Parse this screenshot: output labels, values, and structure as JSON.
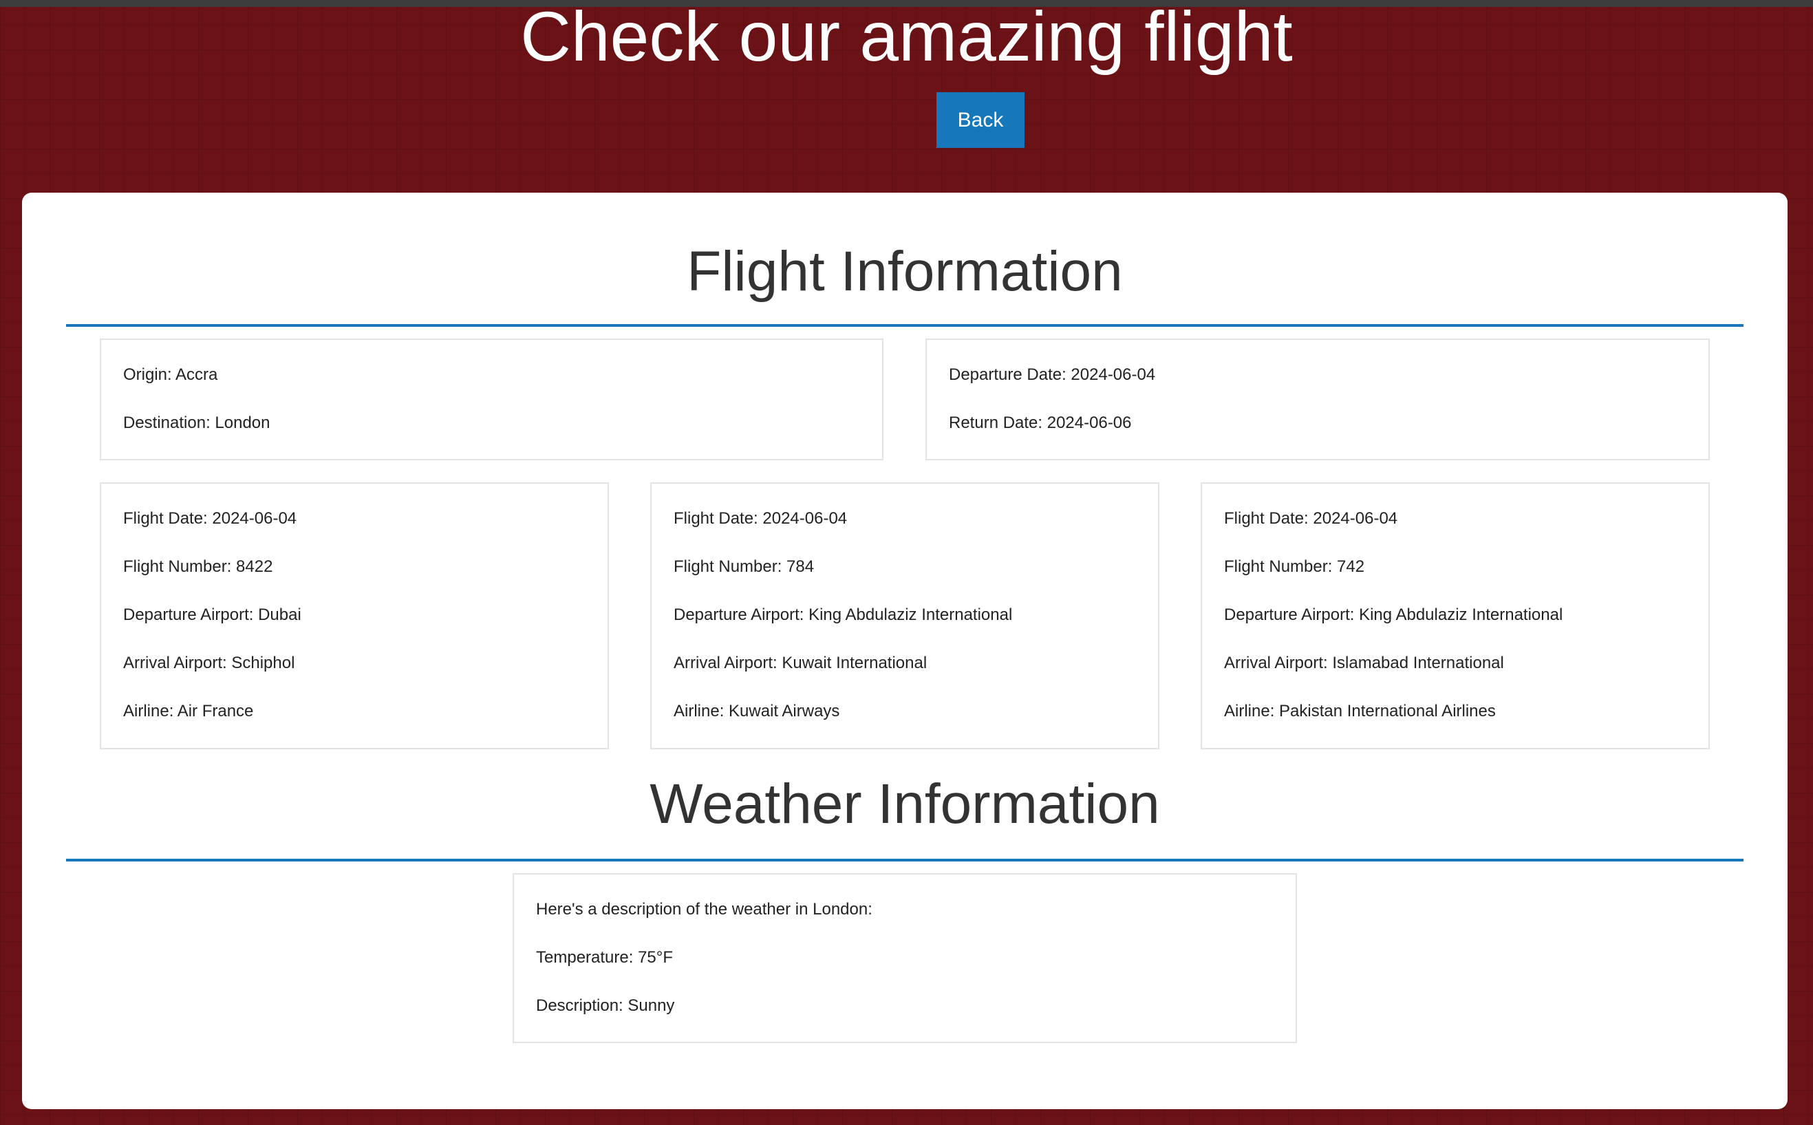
{
  "header": {
    "title": "Check our amazing flight",
    "back_label": "Back"
  },
  "flight_section": {
    "title": "Flight Information",
    "route": {
      "origin": "Origin: Accra",
      "destination": "Destination: London"
    },
    "dates": {
      "departure": "Departure Date: 2024-06-04",
      "return": "Return Date: 2024-06-06"
    },
    "flights": [
      {
        "date": "Flight Date: 2024-06-04",
        "number": "Flight Number: 8422",
        "departure_airport": "Departure Airport: Dubai",
        "arrival_airport": "Arrival Airport: Schiphol",
        "airline": "Airline: Air France"
      },
      {
        "date": "Flight Date: 2024-06-04",
        "number": "Flight Number: 784",
        "departure_airport": "Departure Airport: King Abdulaziz International",
        "arrival_airport": "Arrival Airport: Kuwait International",
        "airline": "Airline: Kuwait Airways"
      },
      {
        "date": "Flight Date: 2024-06-04",
        "number": "Flight Number: 742",
        "departure_airport": "Departure Airport: King Abdulaziz International",
        "arrival_airport": "Arrival Airport: Islamabad International",
        "airline": "Airline: Pakistan International Airlines"
      }
    ]
  },
  "weather_section": {
    "title": "Weather Information",
    "intro": "Here's a description of the weather in London:",
    "temperature": "Temperature: 75°F",
    "description": "Description: Sunny"
  },
  "colors": {
    "background": "#6b1216",
    "accent": "#1677bb",
    "card": "#ffffff",
    "heading_text": "#333333"
  }
}
